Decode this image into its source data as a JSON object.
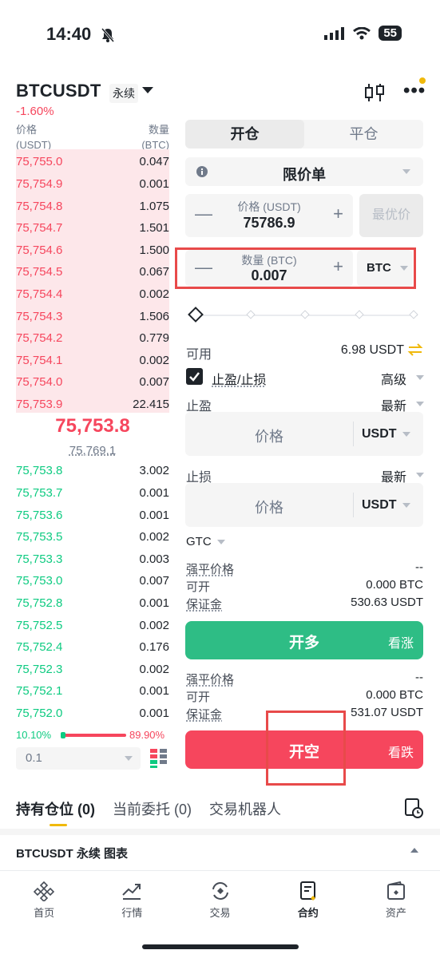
{
  "status_bar": {
    "time": "14:40",
    "battery": "55"
  },
  "header": {
    "symbol": "BTCUSDT",
    "contract_type": "永续",
    "change": "-1.60%"
  },
  "order_book": {
    "price_header": "价格",
    "price_unit": "(USDT)",
    "qty_header": "数量",
    "qty_unit": "(BTC)",
    "asks": [
      {
        "price": "75,755.0",
        "qty": "0.047"
      },
      {
        "price": "75,754.9",
        "qty": "0.001"
      },
      {
        "price": "75,754.8",
        "qty": "1.075"
      },
      {
        "price": "75,754.7",
        "qty": "1.501"
      },
      {
        "price": "75,754.6",
        "qty": "1.500"
      },
      {
        "price": "75,754.5",
        "qty": "0.067"
      },
      {
        "price": "75,754.4",
        "qty": "0.002"
      },
      {
        "price": "75,754.3",
        "qty": "1.506"
      },
      {
        "price": "75,754.2",
        "qty": "0.779"
      },
      {
        "price": "75,754.1",
        "qty": "0.002"
      },
      {
        "price": "75,754.0",
        "qty": "0.007"
      },
      {
        "price": "75,753.9",
        "qty": "22.415"
      }
    ],
    "last_price": "75,753.8",
    "mark_price": "75,769.1",
    "bids": [
      {
        "price": "75,753.8",
        "qty": "3.002"
      },
      {
        "price": "75,753.7",
        "qty": "0.001"
      },
      {
        "price": "75,753.6",
        "qty": "0.001"
      },
      {
        "price": "75,753.5",
        "qty": "0.002"
      },
      {
        "price": "75,753.3",
        "qty": "0.003"
      },
      {
        "price": "75,753.0",
        "qty": "0.007"
      },
      {
        "price": "75,752.8",
        "qty": "0.001"
      },
      {
        "price": "75,752.5",
        "qty": "0.002"
      },
      {
        "price": "75,752.4",
        "qty": "0.176"
      },
      {
        "price": "75,752.3",
        "qty": "0.002"
      },
      {
        "price": "75,752.1",
        "qty": "0.001"
      },
      {
        "price": "75,752.0",
        "qty": "0.001"
      }
    ],
    "buy_ratio": "10.10%",
    "sell_ratio": "89.90%",
    "depth_step": "0.1"
  },
  "order_form": {
    "tab_open": "开仓",
    "tab_close": "平仓",
    "order_type": "限价单",
    "price_label": "价格 (USDT)",
    "price_value": "75786.9",
    "best_price": "最优价",
    "qty_label": "数量 (BTC)",
    "qty_value": "0.007",
    "qty_unit": "BTC",
    "available_label": "可用",
    "available_value": "6.98 USDT",
    "tpsl_label": "止盈/止损",
    "advanced": "高级",
    "tp_label": "止盈",
    "tp_trigger": "最新",
    "tp_price_placeholder": "价格",
    "tp_unit": "USDT",
    "sl_label": "止损",
    "sl_trigger": "最新",
    "sl_price_placeholder": "价格",
    "sl_unit": "USDT",
    "tif": "GTC",
    "long": {
      "liq_label": "强平价格",
      "liq_value": "--",
      "max_label": "可开",
      "max_value": "0.000 BTC",
      "margin_label": "保证金",
      "margin_value": "530.63 USDT"
    },
    "long_button": "开多",
    "long_sub": "看涨",
    "short": {
      "liq_label": "强平价格",
      "liq_value": "--",
      "max_label": "可开",
      "max_value": "0.000 BTC",
      "margin_label": "保证金",
      "margin_value": "531.07 USDT"
    },
    "short_button": "开空",
    "short_sub": "看跌"
  },
  "bottom_tabs": {
    "positions": "持有仓位 (0)",
    "open_orders": "当前委托 (0)",
    "bots": "交易机器人"
  },
  "chart_bar": {
    "label": "BTCUSDT 永续 图表"
  },
  "nav": {
    "home": "首页",
    "markets": "行情",
    "trade": "交易",
    "futures": "合约",
    "assets": "资产"
  },
  "colors": {
    "ask": "#f6465d",
    "bid": "#0ecb81",
    "accent": "#f0b90b",
    "long": "#2ebd85",
    "short": "#f6465d"
  }
}
